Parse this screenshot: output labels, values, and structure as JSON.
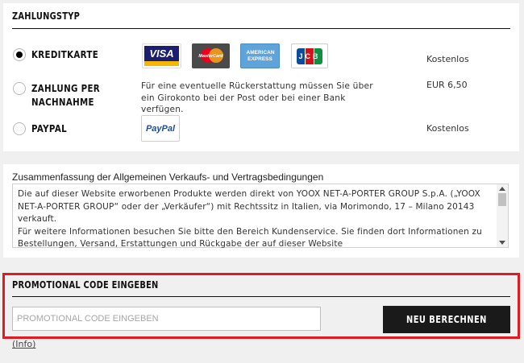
{
  "payment": {
    "title": "ZAHLUNGSTYP",
    "options": [
      {
        "label": "KREDITKARTE",
        "price": "Kostenlos",
        "selected": true
      },
      {
        "label": "ZAHLUNG PER\nNACHNAHME",
        "price": "EUR 6,50",
        "selected": false,
        "info": "Für eine eventuelle Rückerstattung müssen Sie über ein Girokonto bei der Post oder bei einer Bank verfügen."
      },
      {
        "label": "PAYPAL",
        "price": "Kostenlos",
        "selected": false
      }
    ],
    "cards": [
      {
        "name": "visa",
        "text": "VISA"
      },
      {
        "name": "mastercard",
        "text": "MasterCard"
      },
      {
        "name": "amex",
        "text": "AMERICAN EXPRESS"
      },
      {
        "name": "jcb",
        "text": "JCB"
      }
    ],
    "paypal_text": "PayPal"
  },
  "terms": {
    "title": "Zusammenfassung der Allgemeinen Verkaufs- und Vertragsbedingungen",
    "body": "Die auf dieser Website erworbenen Produkte werden direkt von YOOX NET-A-PORTER GROUP S.p.A. („YOOX NET-A-PORTER GROUP“ oder der „Verkäufer“) mit Rechtssitz in Italien, via Morimondo, 17 – Milano 20143 verkauft.\nFür weitere Informationen besuchen Sie bitte den Bereich Kundenservice. Sie finden dort Informationen zu Bestellungen, Versand, Erstattungen und Rückgabe der auf dieser Website"
  },
  "promo": {
    "title": "PROMOTIONAL CODE EINGEBEN",
    "placeholder": "PROMOTIONAL CODE EINGEBEN",
    "button": "NEU BERECHNEN",
    "info_link": "(Info)",
    "highlight_color": "#e01b22"
  },
  "colors": {
    "button_bg": "#1a1a1a",
    "visa_blue": "#1a1f71",
    "visa_gold": "#f7b600",
    "amex_blue": "#5ea3d9",
    "page_bg": "#f0f0f0"
  }
}
